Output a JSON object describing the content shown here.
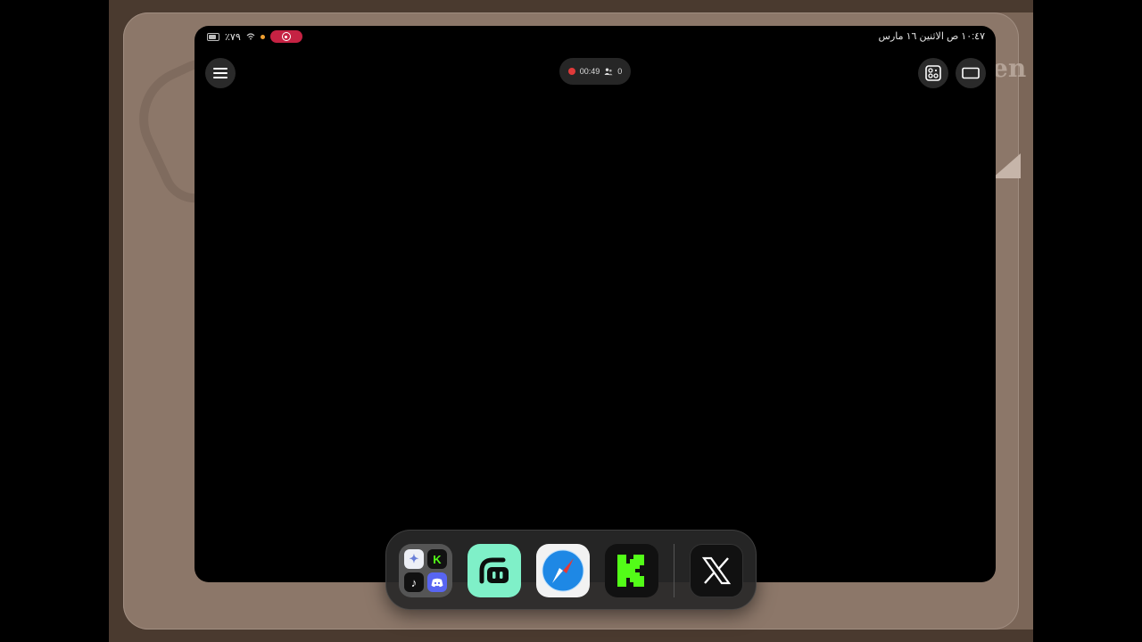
{
  "status_bar": {
    "battery": "٪٧٩",
    "datetime": "١٠:٤٧ ص  الاثنين ١٦ مارس"
  },
  "recording": {
    "timer": "00:49",
    "viewers": "0"
  },
  "wallpaper": {
    "text_fragment": "en"
  },
  "dock": {
    "folder_apps": [
      "spark-icon",
      "kick-icon",
      "tiktok-icon",
      "discord-icon"
    ],
    "apps": [
      "streamlabs-icon",
      "safari-icon",
      "kick-icon",
      "x-icon"
    ]
  },
  "colors": {
    "recording_pill": "#c52243",
    "kick_green": "#53fc18",
    "streamlabs_mint": "#7ff0c8"
  }
}
